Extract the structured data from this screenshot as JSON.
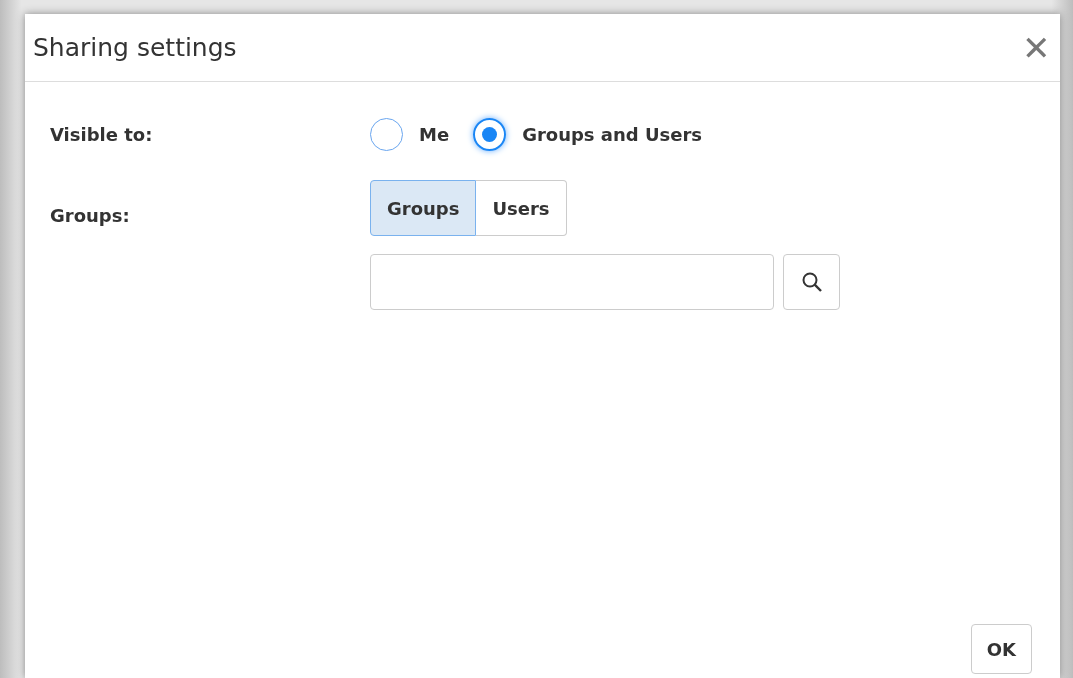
{
  "dialog": {
    "title": "Sharing settings",
    "close": "✕"
  },
  "visibility": {
    "label": "Visible to:",
    "options": [
      {
        "label": "Me",
        "selected": false
      },
      {
        "label": "Groups and Users",
        "selected": true
      }
    ]
  },
  "groups": {
    "label": "Groups:",
    "tabs": [
      {
        "label": "Groups",
        "selected": true
      },
      {
        "label": "Users",
        "selected": false
      }
    ]
  },
  "buttons": [
    {
      "label": "OK"
    }
  ]
}
